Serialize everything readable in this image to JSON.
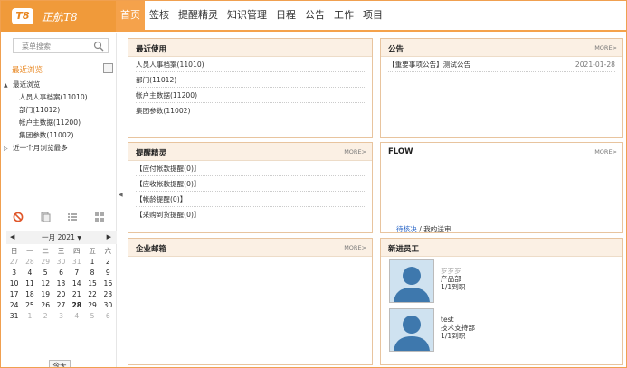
{
  "app": {
    "logo_badge": "T8",
    "logo_name": "正航T8"
  },
  "nav": {
    "tabs": [
      {
        "label": "首页"
      },
      {
        "label": "签核"
      },
      {
        "label": "提醒精灵"
      },
      {
        "label": "知识管理"
      },
      {
        "label": "日程"
      },
      {
        "label": "公告"
      },
      {
        "label": "工作"
      },
      {
        "label": "项目"
      }
    ]
  },
  "sidebar": {
    "search_placeholder": "菜单搜索",
    "recent_title": "最近浏览",
    "tree": [
      {
        "label": "最近浏览",
        "toggle": "▲"
      },
      {
        "label": "人员人事档案(11010)"
      },
      {
        "label": "部门(11012)"
      },
      {
        "label": "帐户主数据(11200)"
      },
      {
        "label": "集团参数(11002)"
      },
      {
        "label": "近一个月浏览最多",
        "toggle": "▷"
      }
    ]
  },
  "calendar": {
    "month_label": "一月 2021",
    "weekdays": [
      "日",
      "一",
      "二",
      "三",
      "四",
      "五",
      "六"
    ],
    "weeks": [
      [
        "27",
        "28",
        "29",
        "30",
        "31",
        "1",
        "2"
      ],
      [
        "3",
        "4",
        "5",
        "6",
        "7",
        "8",
        "9"
      ],
      [
        "10",
        "11",
        "12",
        "13",
        "14",
        "15",
        "16"
      ],
      [
        "17",
        "18",
        "19",
        "20",
        "21",
        "22",
        "23"
      ],
      [
        "24",
        "25",
        "26",
        "27",
        "28",
        "29",
        "30"
      ],
      [
        "31",
        "1",
        "2",
        "3",
        "4",
        "5",
        "6"
      ]
    ],
    "today_label": "今天"
  },
  "panels": {
    "recent": {
      "title": "最近使用",
      "items": [
        "人员人事档案(11010)",
        "部门(11012)",
        "帐户主数据(11200)",
        "集团参数(11002)"
      ]
    },
    "notice": {
      "title": "公告",
      "more": "MORE>",
      "items": [
        {
          "text": "【重要事项公告】测试公告",
          "date": "2021-01-28"
        }
      ]
    },
    "alert": {
      "title": "提醒精灵",
      "more": "MORE>",
      "items": [
        "【应付帐款提醒(0)】",
        "【应收帐款提醒(0)】",
        "【帐龄提醒(0)】",
        "【采购到货提醒(0)】"
      ]
    },
    "flow": {
      "title": "FLOW",
      "more": "MORE>",
      "pending": "待核决",
      "sep": "/",
      "mine": "我的送审"
    },
    "mail": {
      "title": "企业邮箱",
      "more": "MORE>"
    },
    "staff": {
      "title": "新进员工",
      "members": [
        {
          "name": "罗罗罗",
          "dept": "产品部",
          "date": "1/1到职"
        },
        {
          "name": "test",
          "dept": "技术支持部",
          "date": "1/1到职"
        }
      ]
    }
  }
}
